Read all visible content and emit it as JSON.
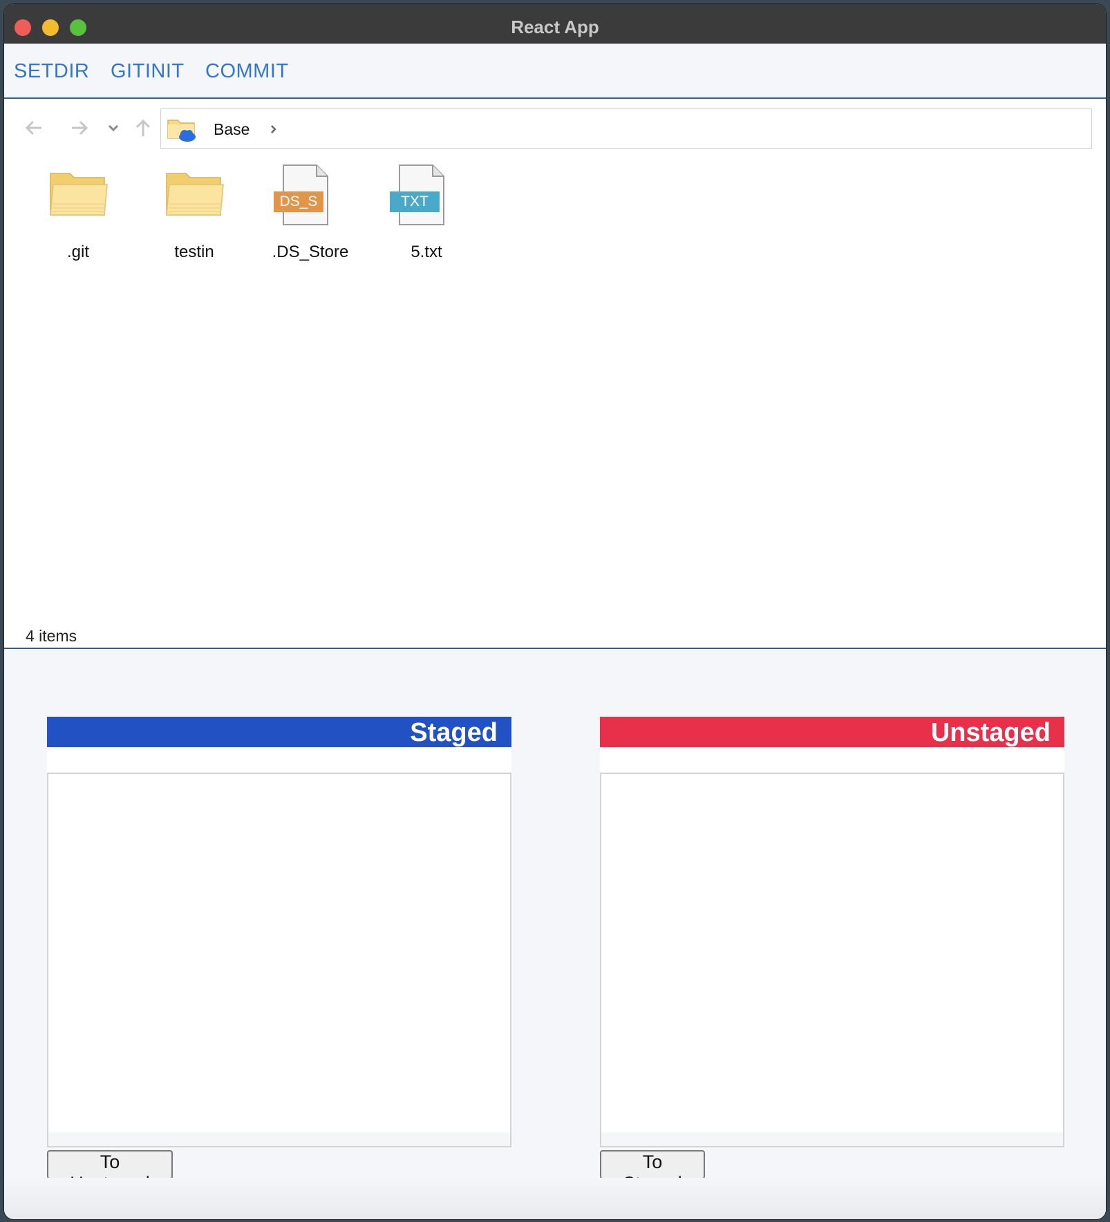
{
  "window": {
    "title": "React App"
  },
  "menu": {
    "items": [
      "SETDIR",
      "GITINIT",
      "COMMIT"
    ]
  },
  "explorer": {
    "breadcrumb": [
      "Base"
    ],
    "files": [
      {
        "name": ".git",
        "type": "folder",
        "icon": "folder-icon"
      },
      {
        "name": "testin",
        "type": "folder",
        "icon": "folder-icon"
      },
      {
        "name": ".DS_Store",
        "type": "file",
        "icon": "ds-store-file-icon",
        "badge": "DS_S",
        "badge_color": "#e0954a"
      },
      {
        "name": "5.txt",
        "type": "file",
        "icon": "txt-file-icon",
        "badge": "TXT",
        "badge_color": "#4aa9c9"
      }
    ],
    "status": "4 items"
  },
  "panels": {
    "staged": {
      "title": "Staged",
      "color": "#2251c4",
      "button": "To Unstaged"
    },
    "unstaged": {
      "title": "Unstaged",
      "color": "#e8304a",
      "button": "To Staged"
    }
  },
  "colors": {
    "menu_link": "#3476c9",
    "explorer_border": "#2e5fa3"
  }
}
